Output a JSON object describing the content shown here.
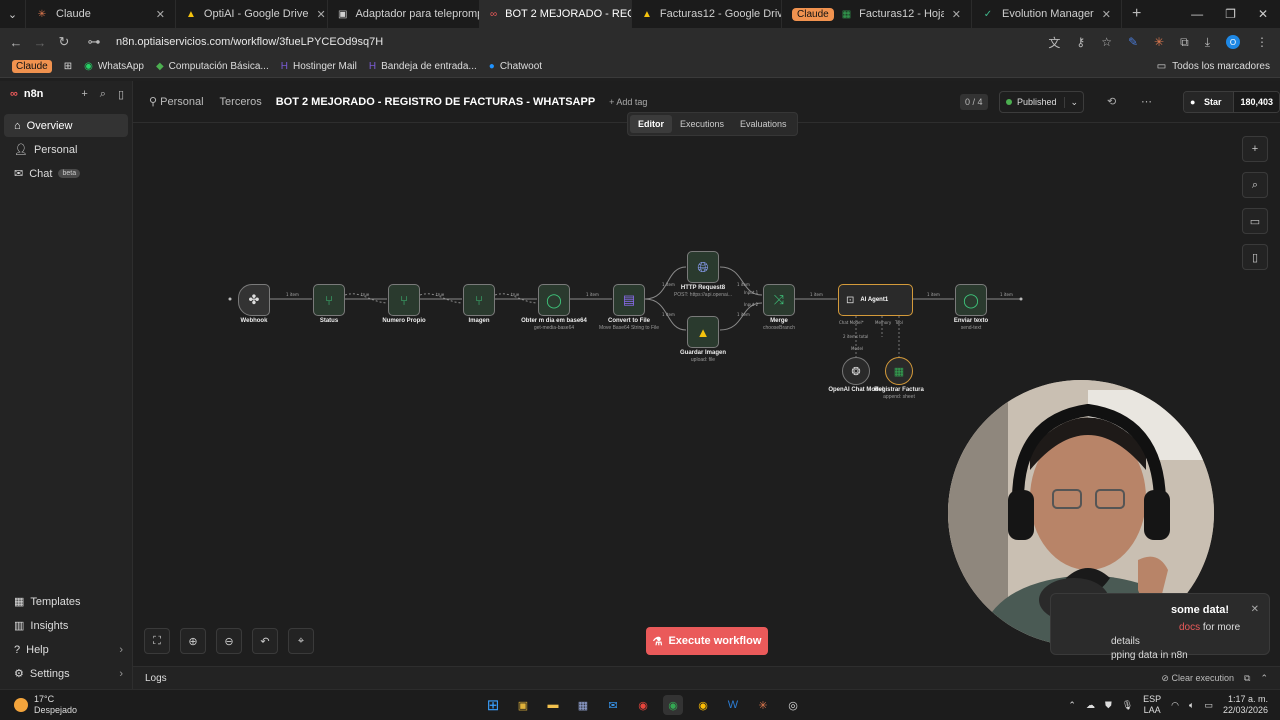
{
  "browser": {
    "tabs": [
      {
        "label": "Claude",
        "icon": "claude-icon",
        "active": false
      },
      {
        "label": "OptiAI - Google Drive",
        "icon": "drive-icon",
        "active": false
      },
      {
        "label": "Adaptador para teleprompter",
        "icon": "page-icon",
        "active": false
      },
      {
        "label": "BOT 2 MEJORADO - REGIS",
        "icon": "n8n-icon",
        "active": true
      },
      {
        "label": "Facturas12 - Google Drive",
        "icon": "drive-icon",
        "active": false
      },
      {
        "label": "Facturas12 - Hojas de cálculo",
        "icon": "sheets-icon",
        "active": false,
        "group": "Claude"
      },
      {
        "label": "Evolution Manager",
        "icon": "evolution-icon",
        "active": false
      }
    ],
    "url": "n8n.optiaiservicios.com/workflow/3fueLPYCEOd9sq7H",
    "bookmarks": [
      {
        "label": "WhatsApp",
        "icon": "whatsapp-icon"
      },
      {
        "label": "Computación Básica...",
        "icon": "diamond-icon"
      },
      {
        "label": "Hostinger Mail",
        "icon": "hostinger-icon"
      },
      {
        "label": "Bandeja de entrada...",
        "icon": "mail-icon"
      },
      {
        "label": "Chatwoot",
        "icon": "chatwoot-icon"
      }
    ],
    "bookmark_group": "Claude",
    "all_bookmarks": "Todos los marcadores"
  },
  "sidebar": {
    "brand": "n8n",
    "items": [
      {
        "label": "Overview",
        "icon": "home-icon",
        "active": true
      },
      {
        "label": "Personal",
        "icon": "user-icon",
        "active": false
      },
      {
        "label": "Chat",
        "icon": "chat-icon",
        "active": false,
        "badge": "beta"
      }
    ],
    "bottom_items": [
      {
        "label": "Templates",
        "icon": "templates-icon"
      },
      {
        "label": "Insights",
        "icon": "insights-icon"
      },
      {
        "label": "Help",
        "icon": "help-icon"
      },
      {
        "label": "Settings",
        "icon": "settings-icon"
      }
    ]
  },
  "header": {
    "crumb_personal": "Personal",
    "crumb_folder": "Terceros",
    "title": "BOT 2 MEJORADO - REGISTRO DE FACTURAS - WHATSAPP",
    "add_tag": "+ Add tag",
    "counter": "0 / 4",
    "status": "Published",
    "star_label": "Star",
    "star_count": "180,403"
  },
  "mode_tabs": [
    "Editor",
    "Executions",
    "Evaluations"
  ],
  "workflow": {
    "nodes": [
      {
        "name": "Webhook",
        "sub": ""
      },
      {
        "name": "Status",
        "sub": ""
      },
      {
        "name": "Numero Propio",
        "sub": ""
      },
      {
        "name": "Imagen",
        "sub": ""
      },
      {
        "name": "Obter m dia em base64",
        "sub": "get-media-base64"
      },
      {
        "name": "Convert to File",
        "sub": "Move Base64 String to File"
      },
      {
        "name": "HTTP Request8",
        "sub": "POST: https://api.openai..."
      },
      {
        "name": "Guardar Imagen",
        "sub": "upload: file"
      },
      {
        "name": "Merge",
        "sub": "chooseBranch"
      },
      {
        "name": "AI Agent1",
        "sub": ""
      },
      {
        "name": "Enviar texto",
        "sub": "send-text"
      },
      {
        "name": "OpenAI Chat Model",
        "sub": ""
      },
      {
        "name": "Registrar Factura",
        "sub": "append: sheet"
      }
    ],
    "edge_labels": {
      "item": "1 item",
      "true": "true",
      "false": "false",
      "input1": "Input 1",
      "input2": "Input 2",
      "chat_model": "Chat Model*",
      "memory": "Memory",
      "tool": "Tool",
      "model_items": "2 items total",
      "model": "Model"
    }
  },
  "canvas": {
    "execute_label": "Execute workflow",
    "logs_label": "Logs",
    "clear_execution": "Clear execution"
  },
  "toast": {
    "title": "some data!",
    "body_link": "docs",
    "body_1": " for more details",
    "body_2": "pping data in n8n"
  },
  "taskbar": {
    "temp": "17°C",
    "weather": "Despejado",
    "lang_1": "ESP",
    "lang_2": "LAA",
    "time": "1:17 a. m.",
    "date": "22/03/2026"
  },
  "colors": {
    "accent": "#ea5a5a",
    "node_green": "#4caf50",
    "published": "#4caf50"
  }
}
